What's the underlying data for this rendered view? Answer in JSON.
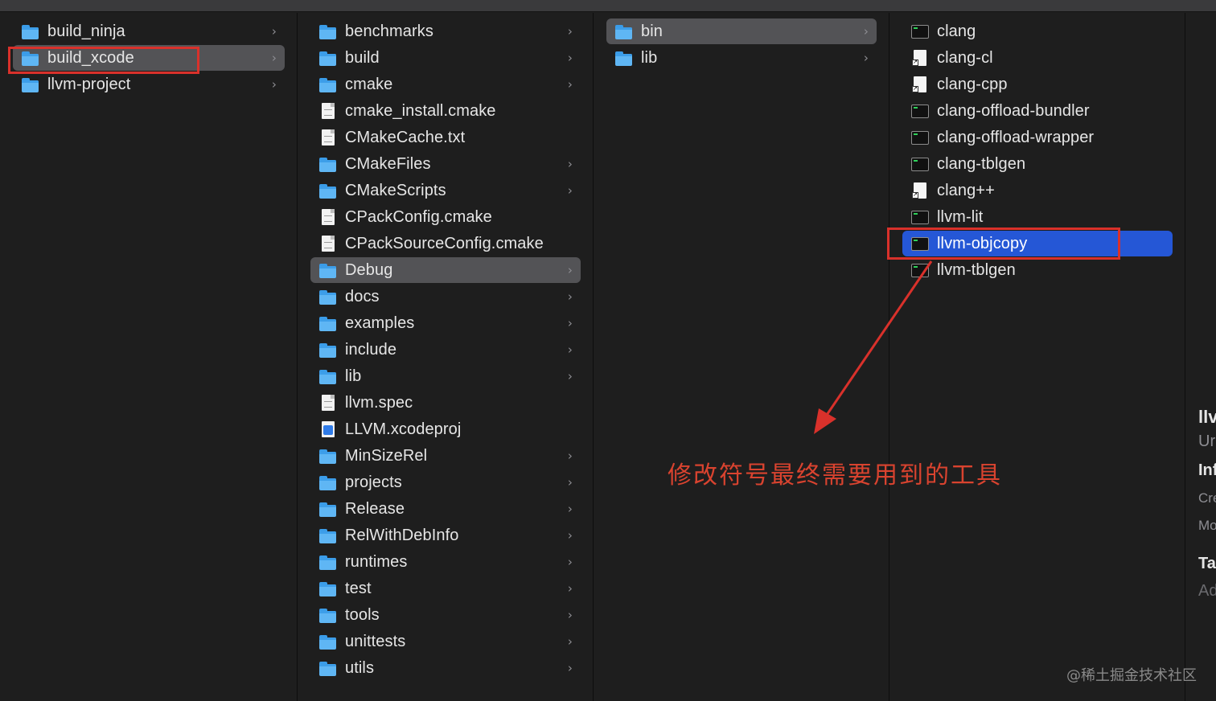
{
  "columns": [
    {
      "items": [
        {
          "label": "build_ninja",
          "kind": "folder",
          "chevron": true
        },
        {
          "label": "build_xcode",
          "kind": "folder",
          "chevron": true,
          "selected": "gray"
        },
        {
          "label": "llvm-project",
          "kind": "folder",
          "chevron": true
        }
      ]
    },
    {
      "items": [
        {
          "label": "benchmarks",
          "kind": "folder",
          "chevron": true
        },
        {
          "label": "build",
          "kind": "folder",
          "chevron": true
        },
        {
          "label": "cmake",
          "kind": "folder",
          "chevron": true
        },
        {
          "label": "cmake_install.cmake",
          "kind": "doc"
        },
        {
          "label": "CMakeCache.txt",
          "kind": "doc"
        },
        {
          "label": "CMakeFiles",
          "kind": "folder",
          "chevron": true
        },
        {
          "label": "CMakeScripts",
          "kind": "folder",
          "chevron": true
        },
        {
          "label": "CPackConfig.cmake",
          "kind": "doc"
        },
        {
          "label": "CPackSourceConfig.cmake",
          "kind": "doc"
        },
        {
          "label": "Debug",
          "kind": "folder",
          "chevron": true,
          "selected": "gray"
        },
        {
          "label": "docs",
          "kind": "folder",
          "chevron": true
        },
        {
          "label": "examples",
          "kind": "folder",
          "chevron": true
        },
        {
          "label": "include",
          "kind": "folder",
          "chevron": true
        },
        {
          "label": "lib",
          "kind": "folder",
          "chevron": true
        },
        {
          "label": "llvm.spec",
          "kind": "doc"
        },
        {
          "label": "LLVM.xcodeproj",
          "kind": "xproj"
        },
        {
          "label": "MinSizeRel",
          "kind": "folder",
          "chevron": true
        },
        {
          "label": "projects",
          "kind": "folder",
          "chevron": true
        },
        {
          "label": "Release",
          "kind": "folder",
          "chevron": true
        },
        {
          "label": "RelWithDebInfo",
          "kind": "folder",
          "chevron": true
        },
        {
          "label": "runtimes",
          "kind": "folder",
          "chevron": true
        },
        {
          "label": "test",
          "kind": "folder",
          "chevron": true
        },
        {
          "label": "tools",
          "kind": "folder",
          "chevron": true
        },
        {
          "label": "unittests",
          "kind": "folder",
          "chevron": true
        },
        {
          "label": "utils",
          "kind": "folder",
          "chevron": true
        }
      ]
    },
    {
      "items": [
        {
          "label": "bin",
          "kind": "folder",
          "chevron": true,
          "selected": "gray"
        },
        {
          "label": "lib",
          "kind": "folder",
          "chevron": true
        }
      ]
    },
    {
      "items": [
        {
          "label": "clang",
          "kind": "exec"
        },
        {
          "label": "clang-cl",
          "kind": "alias"
        },
        {
          "label": "clang-cpp",
          "kind": "alias"
        },
        {
          "label": "clang-offload-bundler",
          "kind": "exec"
        },
        {
          "label": "clang-offload-wrapper",
          "kind": "exec"
        },
        {
          "label": "clang-tblgen",
          "kind": "exec"
        },
        {
          "label": "clang++",
          "kind": "alias"
        },
        {
          "label": "llvm-lit",
          "kind": "exec"
        },
        {
          "label": "llvm-objcopy",
          "kind": "exec",
          "selected": "blue"
        },
        {
          "label": "llvm-tblgen",
          "kind": "exec"
        }
      ]
    }
  ],
  "preview": {
    "title": "llv",
    "subtitle": "Ur",
    "info_heading": "Inf",
    "created_label": "Cre",
    "modified_label": "Mo",
    "tags_heading": "Ta",
    "add_tags": "Ad"
  },
  "annotation": {
    "text": "修改符号最终需要用到的工具",
    "color": "#d9432f"
  },
  "watermark": "@稀土掘金技术社区",
  "colors": {
    "selection_gray": "#535356",
    "selection_blue": "#2557d6",
    "highlight_red": "#d9312b",
    "folder_blue": "#5fb6f4"
  }
}
